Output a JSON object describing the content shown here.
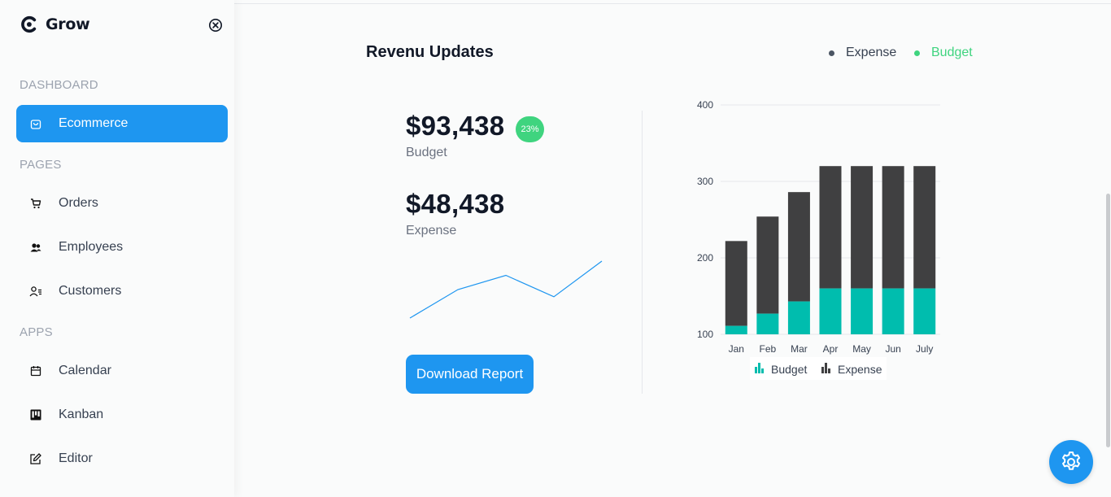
{
  "brand": {
    "name": "Grow"
  },
  "sidebar": {
    "sections": [
      {
        "title": "DASHBOARD",
        "items": [
          {
            "label": "Ecommerce",
            "icon": "shopping-bag-icon",
            "active": true
          }
        ]
      },
      {
        "title": "PAGES",
        "items": [
          {
            "label": "Orders",
            "icon": "cart-icon"
          },
          {
            "label": "Employees",
            "icon": "users-icon"
          },
          {
            "label": "Customers",
            "icon": "user-list-icon"
          }
        ]
      },
      {
        "title": "APPS",
        "items": [
          {
            "label": "Calendar",
            "icon": "calendar-icon"
          },
          {
            "label": "Kanban",
            "icon": "kanban-icon"
          },
          {
            "label": "Editor",
            "icon": "edit-icon"
          }
        ]
      }
    ]
  },
  "revenue": {
    "title": "Revenu Updates",
    "legend": {
      "expense_label": "Expense",
      "budget_label": "Budget"
    },
    "budget_value": "$93,438",
    "budget_change": "23%",
    "budget_label": "Budget",
    "expense_value": "$48,438",
    "expense_label": "Expense",
    "download_label": "Download Report",
    "sparkline": {
      "values": [
        2,
        6,
        8,
        5,
        10
      ]
    }
  },
  "chart_data": {
    "type": "bar",
    "stacked": true,
    "categories": [
      "Jan",
      "Feb",
      "Mar",
      "Apr",
      "May",
      "Jun",
      "July"
    ],
    "series": [
      {
        "name": "Budget",
        "values": [
          111,
          127,
          143,
          160,
          160,
          160,
          160
        ],
        "color": "#00bdae"
      },
      {
        "name": "Expense",
        "values": [
          111,
          127,
          143,
          160,
          160,
          160,
          160
        ],
        "color": "#404041"
      }
    ],
    "y_ticks": [
      "100",
      "200",
      "300",
      "400"
    ],
    "ylim": [
      100,
      400
    ],
    "grid": true,
    "legend_position": "bottom"
  },
  "colors": {
    "accent": "#1e96f0",
    "budget": "#00bdae",
    "expense": "#404041",
    "badge": "#3fd47f"
  }
}
